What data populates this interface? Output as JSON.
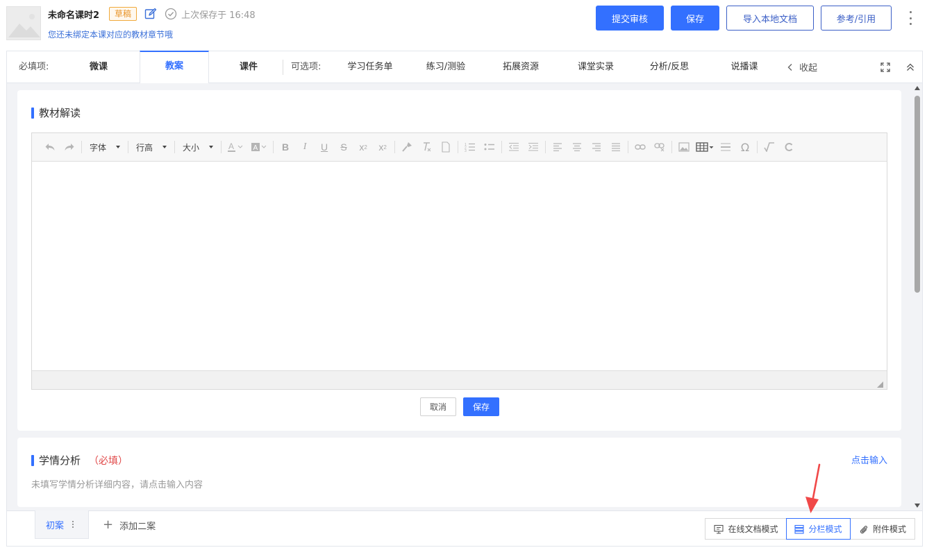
{
  "header": {
    "course_title": "未命名课时2",
    "draft_badge": "草稿",
    "last_saved": "上次保存于 16:48",
    "bind_hint": "您还未绑定本课对应的教材章节哦",
    "buttons": {
      "submit_review": "提交审核",
      "save": "保存",
      "import_local_doc": "导入本地文档",
      "reference": "参考/引用"
    }
  },
  "tabs": {
    "required_label": "必填项:",
    "optional_label": "可选项:",
    "required": [
      {
        "label": "微课",
        "active": false
      },
      {
        "label": "教案",
        "active": true
      },
      {
        "label": "课件",
        "active": false
      }
    ],
    "optional": [
      {
        "label": "学习任务单"
      },
      {
        "label": "练习/测验"
      },
      {
        "label": "拓展资源"
      },
      {
        "label": "课堂实录"
      },
      {
        "label": "分析/反思"
      },
      {
        "label": "说播课"
      }
    ],
    "collapse": "收起"
  },
  "sections": {
    "textbook": {
      "title": "教材解读",
      "toolbar": {
        "font": "字体",
        "line_height": "行高",
        "size": "大小"
      },
      "cancel": "取消",
      "save": "保存"
    },
    "learner": {
      "title": "学情分析",
      "required_mark": "（必填）",
      "action": "点击输入",
      "placeholder": "未填写学情分析详细内容，请点击输入内容"
    }
  },
  "bottom": {
    "plan_tab": "初案",
    "add_plan": "添加二案",
    "modes": [
      {
        "label": "在线文档模式",
        "icon": "monitor-icon",
        "active": false
      },
      {
        "label": "分栏模式",
        "icon": "columns-icon",
        "active": true
      },
      {
        "label": "附件模式",
        "icon": "paperclip-icon",
        "active": false
      }
    ]
  },
  "colors": {
    "primary": "#3370ff",
    "draft": "#e8952a",
    "required": "#e04848",
    "annotation_arrow": "#f04848"
  }
}
